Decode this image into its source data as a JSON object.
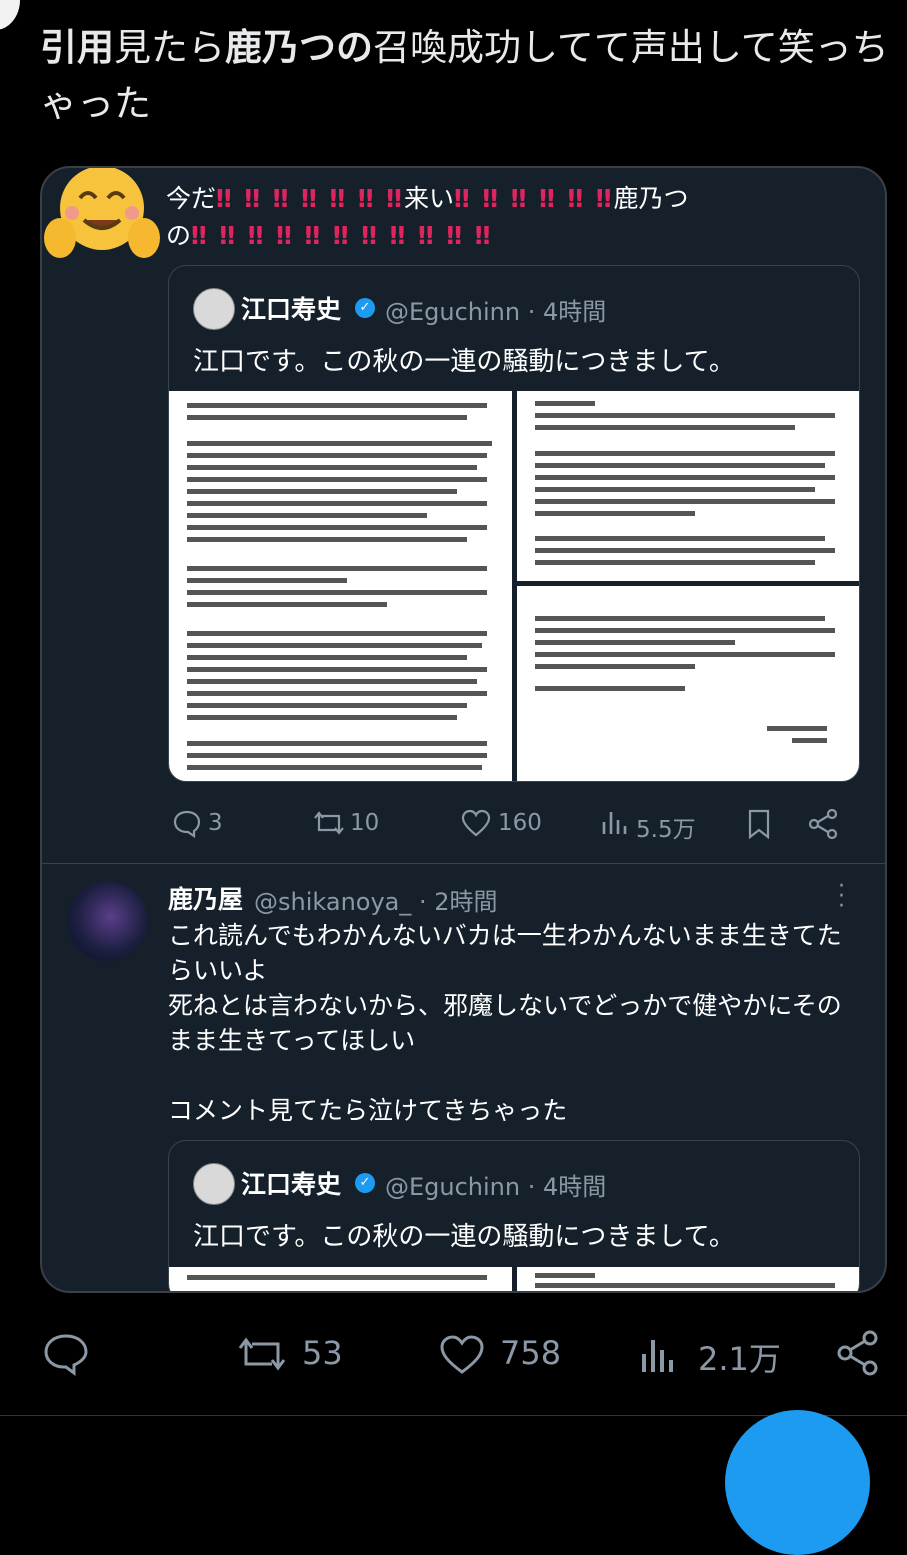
{
  "post": {
    "text_prefix_bold": "引用",
    "text_mid1": "見たら",
    "text_name_bold": "鹿乃つの",
    "text_rest": "召喚成功してて声出して笑っちゃった"
  },
  "embedded": {
    "reply_before": "今だ",
    "reply_bangs_1": "‼ ‼ ‼ ‼ ‼ ‼ ‼",
    "reply_middle": "来い",
    "reply_bangs_2": "‼ ‼ ‼ ‼ ‼ ‼",
    "reply_name": "鹿乃つ",
    "reply_line2_start": "の",
    "reply_bangs_3": "‼ ‼ ‼ ‼ ‼ ‼ ‼ ‼ ‼ ‼ ‼",
    "quote1": {
      "name": "江口寿史",
      "handle": "@Eguchinn · 4時間",
      "body": "江口です。この秋の一連の騒動につきまして。"
    },
    "actions": {
      "replies": "3",
      "retweets": "10",
      "likes": "160",
      "views": "5.5万"
    },
    "reply2": {
      "name": "鹿乃屋",
      "handle": "@shikanoya_ · 2時間",
      "text": "これ読んでもわかんないバカは一生わかんないまま生きてたらいいよ\n死ねとは言わないから、邪魔しないでどっかで健やかにそのまま生きてってほしい\n\nコメント見てたら泣けてきちゃった"
    },
    "quote2": {
      "name": "江口寿史",
      "handle": "@Eguchinn · 4時間",
      "body": "江口です。この秋の一連の騒動につきまして。"
    }
  },
  "bottom_actions": {
    "retweets": "53",
    "likes": "758",
    "views": "2.1万"
  },
  "colors": {
    "background": "#000000",
    "card": "#15202b",
    "accent": "#1d9bf0",
    "bang_red": "#e0245e",
    "muted": "#8b98a5"
  }
}
